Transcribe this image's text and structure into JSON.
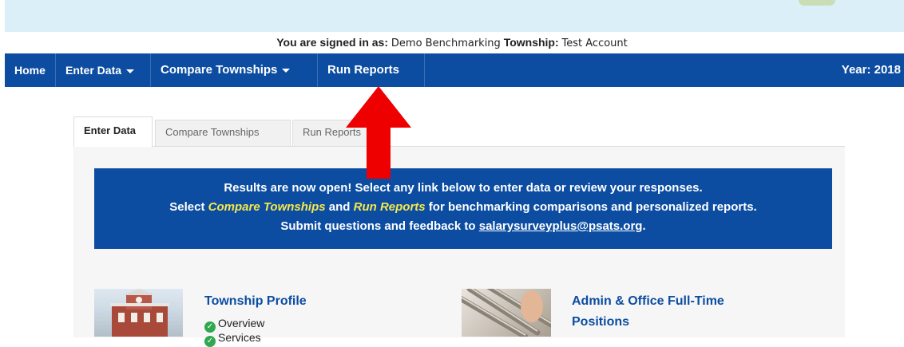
{
  "signed_in": {
    "label_user": "You are signed in as:",
    "user": "Demo Benchmarking",
    "label_township": "Township:",
    "township": "Test Account"
  },
  "nav": {
    "home": "Home",
    "enter_data": "Enter Data",
    "compare": "Compare Townships",
    "run_reports": "Run Reports",
    "year": "Year: 2018"
  },
  "tabs": {
    "enter_data": "Enter Data",
    "compare": "Compare Townships",
    "run_reports": "Run Reports"
  },
  "banner": {
    "line1": "Results are now open! Select any link below to enter data or review your responses.",
    "line2_pre": "Select",
    "line2_link1": "Compare Townships",
    "line2_and": "and",
    "line2_link2": "Run Reports",
    "line2_post": "for benchmarking comparisons and personalized reports.",
    "line3_pre": "Submit questions and feedback to",
    "email": "salarysurveyplus@psats.org",
    "line3_post": "."
  },
  "cards": {
    "profile_title": "Township Profile",
    "profile_items": [
      "Overview",
      "Services"
    ],
    "admin_title_1": "Admin & Office Full-Time",
    "admin_title_2": "Positions"
  },
  "colors": {
    "nav_bg": "#0c4da2",
    "highlight": "#f6e84a",
    "arrow": "#ee0000",
    "check": "#2fa84f"
  }
}
